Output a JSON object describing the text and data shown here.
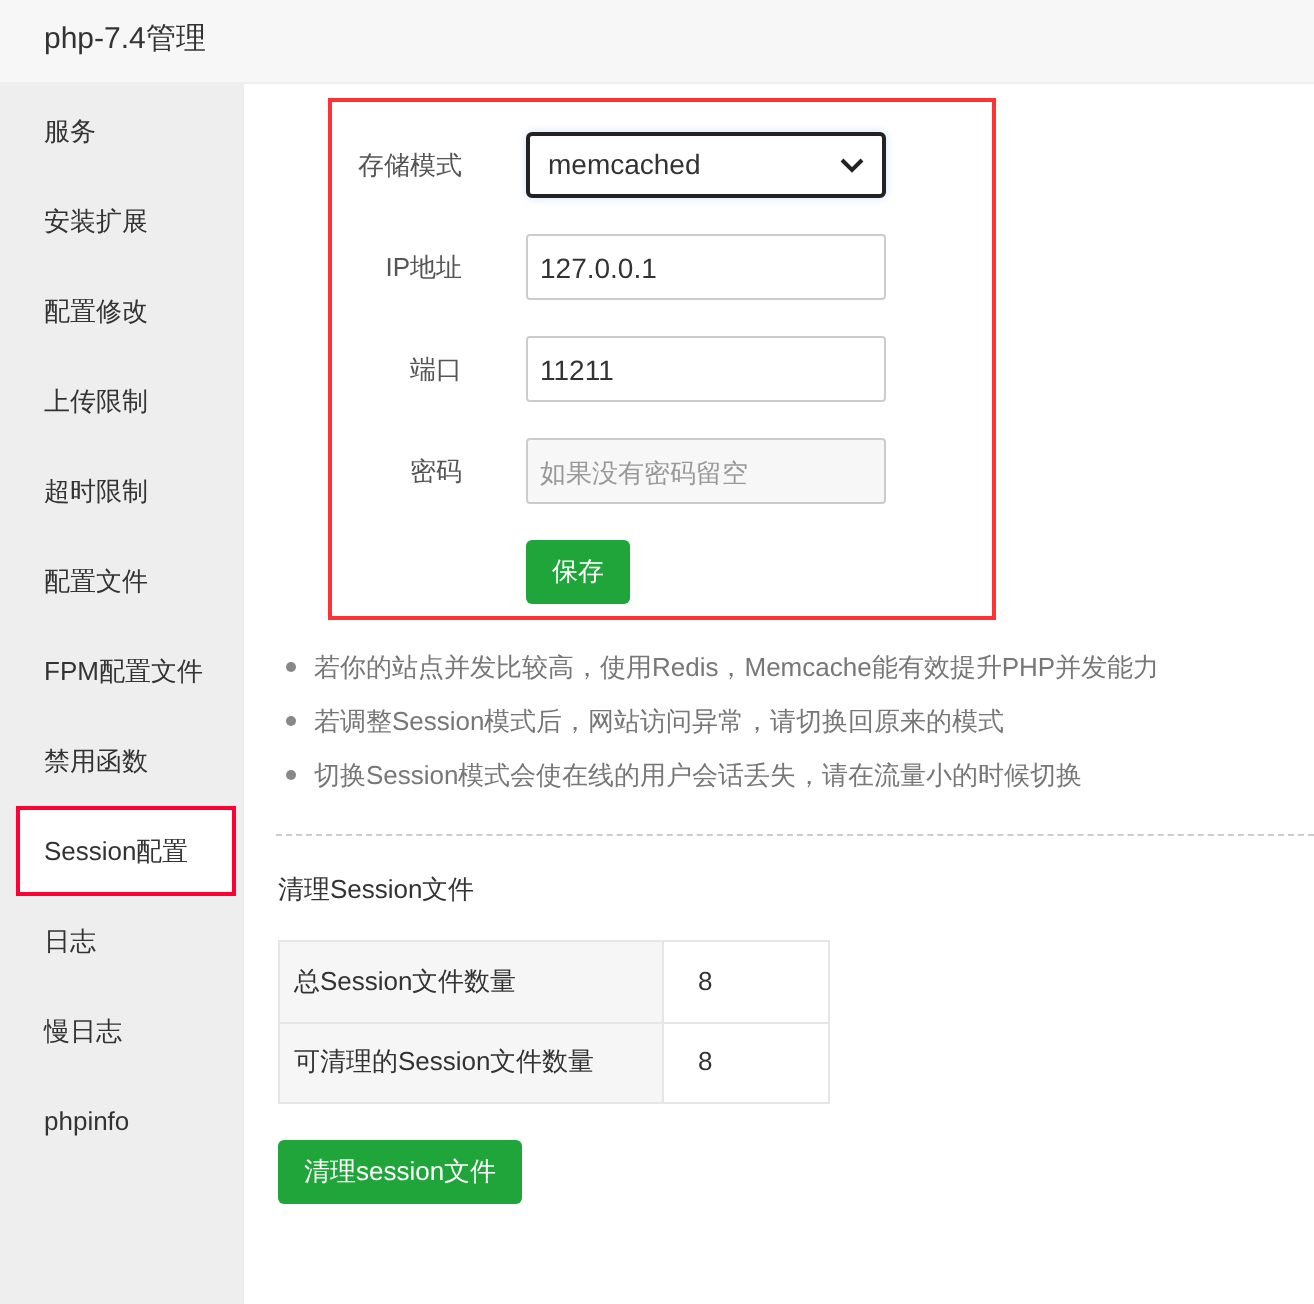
{
  "window": {
    "title": "php-7.4管理"
  },
  "sidebar": {
    "items": [
      {
        "label": "服务",
        "selected": false,
        "highlighted": false
      },
      {
        "label": "安装扩展",
        "selected": false,
        "highlighted": false
      },
      {
        "label": "配置修改",
        "selected": false,
        "highlighted": false
      },
      {
        "label": "上传限制",
        "selected": false,
        "highlighted": false
      },
      {
        "label": "超时限制",
        "selected": false,
        "highlighted": false
      },
      {
        "label": "配置文件",
        "selected": false,
        "highlighted": false
      },
      {
        "label": "FPM配置文件",
        "selected": false,
        "highlighted": false
      },
      {
        "label": "禁用函数",
        "selected": false,
        "highlighted": false
      },
      {
        "label": "Session配置",
        "selected": true,
        "highlighted": true
      },
      {
        "label": "日志",
        "selected": false,
        "highlighted": false
      },
      {
        "label": "慢日志",
        "selected": false,
        "highlighted": false
      },
      {
        "label": "phpinfo",
        "selected": false,
        "highlighted": false
      }
    ]
  },
  "form": {
    "highlighted": true,
    "fields": [
      {
        "kind": "select",
        "label": "存储模式",
        "value": "memcached"
      },
      {
        "kind": "text",
        "label": "IP地址",
        "value": "127.0.0.1"
      },
      {
        "kind": "text",
        "label": "端口",
        "value": "11211"
      },
      {
        "kind": "text",
        "label": "密码",
        "placeholder": "如果没有密码留空",
        "disabled": true
      }
    ],
    "save_button": "保存"
  },
  "tips": [
    "若你的站点并发比较高，使用Redis，Memcache能有效提升PHP并发能力",
    "若调整Session模式后，网站访问异常，请切换回原来的模式",
    "切换Session模式会使在线的用户会话丢失，请在流量小的时候切换"
  ],
  "cleanup": {
    "title": "清理Session文件",
    "rows": [
      {
        "label": "总Session文件数量",
        "value": "8"
      },
      {
        "label": "可清理的Session文件数量",
        "value": "8"
      }
    ],
    "button": "清理session文件"
  }
}
